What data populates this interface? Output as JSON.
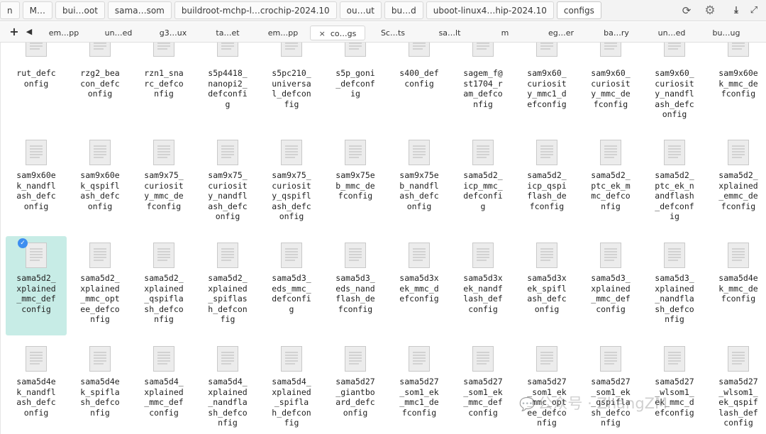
{
  "pathbar": {
    "crumbs": [
      "n",
      "M…",
      "bui…oot",
      "sama…som",
      "buildroot-mchp-l…crochip-2024.10",
      "ou…ut",
      "bu…d",
      "uboot-linux4…hip-2024.10",
      "configs"
    ],
    "refresh_icon": "refresh-icon",
    "settings_icon": "gear-icon",
    "download_icon": "download-icon",
    "expand_icon": "expand-icon"
  },
  "tabs": {
    "add_glyph": "+",
    "prev_glyph": "◀",
    "close_glyph": "×",
    "active_index": 5,
    "items": [
      "em…pp",
      "un…ed",
      "g3…ux",
      "ta…et",
      "em…pp",
      "co…gs",
      "Sc…ts",
      "sa…lt",
      "m",
      "eg…er",
      "ba…ry",
      "un…ed",
      "bu…ug"
    ]
  },
  "files": {
    "selected_index": 24,
    "rows": [
      [
        {
          "name": "rut_defconfig",
          "lines": [
            "rut_defc",
            "onfig"
          ]
        },
        {
          "name": "rzg2_beacon_defconfig",
          "lines": [
            "rzg2_bea",
            "con_defc",
            "onfig"
          ]
        },
        {
          "name": "rzn1_snarc_defconfig",
          "lines": [
            "rzn1_sna",
            "rc_defco",
            "nfig"
          ]
        },
        {
          "name": "s5p4418_nanopi2_defconfig",
          "lines": [
            "s5p4418_",
            "nanopi2_",
            "defconfi",
            "g"
          ]
        },
        {
          "name": "s5pc210_universal_defconfig",
          "lines": [
            "s5pc210_",
            "universa",
            "l_defcon",
            "fig"
          ]
        },
        {
          "name": "s5p_goni_defconfig",
          "lines": [
            "s5p_goni",
            "_defconf",
            "ig"
          ]
        },
        {
          "name": "s400_defconfig",
          "lines": [
            "s400_def",
            "config"
          ]
        },
        {
          "name": "sagem_f@st1704_ram_defconfig",
          "lines": [
            "sagem_f@",
            "st1704_r",
            "am_defco",
            "nfig"
          ]
        },
        {
          "name": "sam9x60_curiosity_mmc1_defconfig",
          "lines": [
            "sam9x60_",
            "curiosit",
            "y_mmc1_d",
            "efconfig"
          ]
        },
        {
          "name": "sam9x60_curiosity_mmc_defconfig",
          "lines": [
            "sam9x60_",
            "curiosit",
            "y_mmc_de",
            "fconfig"
          ]
        },
        {
          "name": "sam9x60_curiosity_nandflash_defconfig",
          "lines": [
            "sam9x60_",
            "curiosit",
            "y_nandfl",
            "ash_defc",
            "onfig"
          ]
        },
        {
          "name": "sam9x60ek_mmc_defconfig",
          "lines": [
            "sam9x60e",
            "k_mmc_de",
            "fconfig"
          ]
        }
      ],
      [
        {
          "name": "sam9x60ek_nandflash_defconfig",
          "lines": [
            "sam9x60e",
            "k_nandfl",
            "ash_defc",
            "onfig"
          ]
        },
        {
          "name": "sam9x60ek_qspiflash_defconfig",
          "lines": [
            "sam9x60e",
            "k_qspifl",
            "ash_defc",
            "onfig"
          ]
        },
        {
          "name": "sam9x75_curiosity_mmc_defconfig",
          "lines": [
            "sam9x75_",
            "curiosit",
            "y_mmc_de",
            "fconfig"
          ]
        },
        {
          "name": "sam9x75_curiosity_nandflash_defconfig",
          "lines": [
            "sam9x75_",
            "curiosit",
            "y_nandfl",
            "ash_defc",
            "onfig"
          ]
        },
        {
          "name": "sam9x75_curiosity_qspiflash_defconfig",
          "lines": [
            "sam9x75_",
            "curiosit",
            "y_qspifl",
            "ash_defc",
            "onfig"
          ]
        },
        {
          "name": "sam9x75eb_mmc_defconfig",
          "lines": [
            "sam9x75e",
            "b_mmc_de",
            "fconfig"
          ]
        },
        {
          "name": "sam9x75eb_nandflash_defconfig",
          "lines": [
            "sam9x75e",
            "b_nandfl",
            "ash_defc",
            "onfig"
          ]
        },
        {
          "name": "sama5d2_icp_mmc_defconfig",
          "lines": [
            "sama5d2_",
            "icp_mmc_",
            "defconfi",
            "g"
          ]
        },
        {
          "name": "sama5d2_icp_qspiflash_defconfig",
          "lines": [
            "sama5d2_",
            "icp_qspi",
            "flash_de",
            "fconfig"
          ]
        },
        {
          "name": "sama5d2_ptc_ek_mmc_defconfig",
          "lines": [
            "sama5d2_",
            "ptc_ek_m",
            "mc_defco",
            "nfig"
          ]
        },
        {
          "name": "sama5d2_ptc_ek_nandflash_defconfig",
          "lines": [
            "sama5d2_",
            "ptc_ek_n",
            "andflash",
            "_defconf",
            "ig"
          ]
        },
        {
          "name": "sama5d2_xplained_emmc_defconfig",
          "lines": [
            "sama5d2_",
            "xplained",
            "_emmc_de",
            "fconfig"
          ]
        }
      ],
      [
        {
          "name": "sama5d2_xplained_mmc_defconfig",
          "lines": [
            "sama5d2_",
            "xplained",
            "_mmc_def",
            "config"
          ]
        },
        {
          "name": "sama5d2_xplained_mmc_optee_defconfig",
          "lines": [
            "sama5d2_",
            "xplained",
            "_mmc_opt",
            "ee_defco",
            "nfig"
          ]
        },
        {
          "name": "sama5d2_xplained_qspiflash_defconfig",
          "lines": [
            "sama5d2_",
            "xplained",
            "_qspifla",
            "sh_defco",
            "nfig"
          ]
        },
        {
          "name": "sama5d2_xplained_spiflash_defconfig",
          "lines": [
            "sama5d2_",
            "xplained",
            "_spiflas",
            "h_defcon",
            "fig"
          ]
        },
        {
          "name": "sama5d3_eds_mmc_defconfig",
          "lines": [
            "sama5d3_",
            "eds_mmc_",
            "defconfi",
            "g"
          ]
        },
        {
          "name": "sama5d3_eds_nandflash_defconfig",
          "lines": [
            "sama5d3_",
            "eds_nand",
            "flash_de",
            "fconfig"
          ]
        },
        {
          "name": "sama5d3xek_mmc_defconfig",
          "lines": [
            "sama5d3x",
            "ek_mmc_d",
            "efconfig"
          ]
        },
        {
          "name": "sama5d3xek_nandflash_defconfig",
          "lines": [
            "sama5d3x",
            "ek_nandf",
            "lash_def",
            "config"
          ]
        },
        {
          "name": "sama5d3xek_spiflash_defconfig",
          "lines": [
            "sama5d3x",
            "ek_spifl",
            "ash_defc",
            "onfig"
          ]
        },
        {
          "name": "sama5d3_xplained_mmc_defconfig",
          "lines": [
            "sama5d3_",
            "xplained",
            "_mmc_def",
            "config"
          ]
        },
        {
          "name": "sama5d3_xplained_nandflash_defconfig",
          "lines": [
            "sama5d3_",
            "xplained",
            "_nandfla",
            "sh_defco",
            "nfig"
          ]
        },
        {
          "name": "sama5d4ek_mmc_defconfig",
          "lines": [
            "sama5d4e",
            "k_mmc_de",
            "fconfig"
          ]
        }
      ],
      [
        {
          "name": "sama5d4ek_nandflash_defconfig",
          "lines": [
            "sama5d4e",
            "k_nandfl",
            "ash_defc",
            "onfig"
          ]
        },
        {
          "name": "sama5d4ek_spiflash_defconfig",
          "lines": [
            "sama5d4e",
            "k_spifla",
            "sh_defco",
            "nfig"
          ]
        },
        {
          "name": "sama5d4_xplained_mmc_defconfig",
          "lines": [
            "sama5d4_",
            "xplained",
            "_mmc_def",
            "config"
          ]
        },
        {
          "name": "sama5d4_xplained_nandflash_defconfig",
          "lines": [
            "sama5d4_",
            "xplained",
            "_nandfla",
            "sh_defco",
            "nfig"
          ]
        },
        {
          "name": "sama5d4_xplained_spiflash_defconfig",
          "lines": [
            "sama5d4_",
            "xplained",
            "_spifla",
            "h_defcon",
            "fig"
          ]
        },
        {
          "name": "sama5d27_giantboard_defconfig",
          "lines": [
            "sama5d27",
            "_giantbo",
            "ard_defc",
            "onfig"
          ]
        },
        {
          "name": "sama5d27_som1_ek_mmc1_defconfig",
          "lines": [
            "sama5d27",
            "_som1_ek",
            "_mmc1_de",
            "fconfig"
          ]
        },
        {
          "name": "sama5d27_som1_ek_mmc_defconfig",
          "lines": [
            "sama5d27",
            "_som1_ek",
            "_mmc_def",
            "config"
          ]
        },
        {
          "name": "sama5d27_som1_ek_mmc_optee_defconfig",
          "lines": [
            "sama5d27",
            "_som1_ek",
            "_mmc_opt",
            "ee_defco",
            "nfig"
          ]
        },
        {
          "name": "sama5d27_som1_ek_qspiflash_defconfig",
          "lines": [
            "sama5d27",
            "_som1_ek",
            "_qspifla",
            "sh_defco",
            "nfig"
          ]
        },
        {
          "name": "sama5d27_wlsom1_ek_mmc_defconfig",
          "lines": [
            "sama5d27",
            "_wlsom1_",
            "ek_mmc_d",
            "efconfig"
          ]
        },
        {
          "name": "sama5d27_wlsom1_ek_qspiflash_defconfig",
          "lines": [
            "sama5d27",
            "_wlsom1_",
            "ek_qspif",
            "lash_def",
            "config"
          ]
        }
      ]
    ]
  },
  "watermark": {
    "icon": "chat-bubble-icon",
    "text": "公众号 · ZhangZM"
  },
  "colors": {
    "selected_bg": "#c7ece6",
    "check_badge": "#3d8ef0",
    "file_icon": "#ececec"
  }
}
